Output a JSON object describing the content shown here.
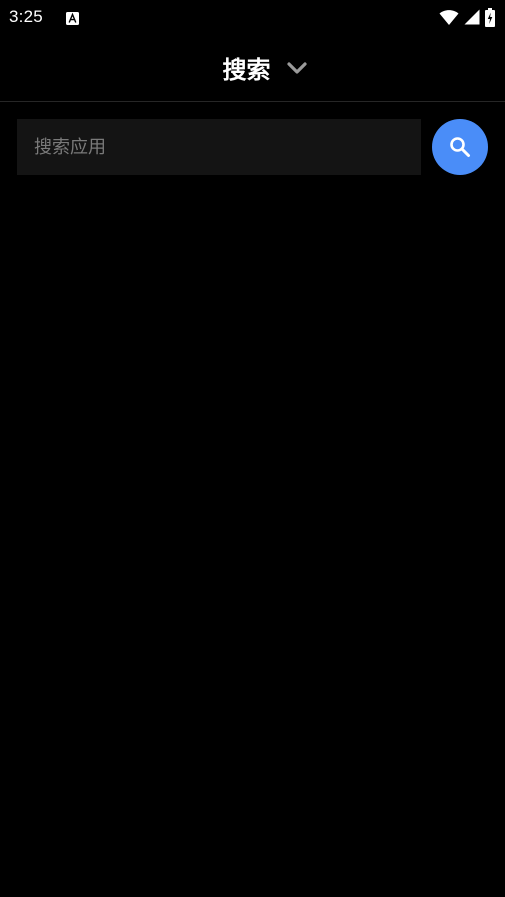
{
  "status_bar": {
    "time": "3:25",
    "notification_icon": "keyboard-a-icon",
    "wifi_icon": "wifi-icon",
    "signal_icon": "cellular-signal-icon",
    "battery_icon": "battery-charging-icon"
  },
  "header": {
    "title": "搜索",
    "dropdown_icon": "chevron-down-icon"
  },
  "search": {
    "placeholder": "搜索应用",
    "value": "",
    "button_icon": "search-icon"
  },
  "colors": {
    "background": "#000000",
    "accent": "#4a8df8",
    "input_background": "#141414",
    "placeholder": "#7a7a7a"
  }
}
